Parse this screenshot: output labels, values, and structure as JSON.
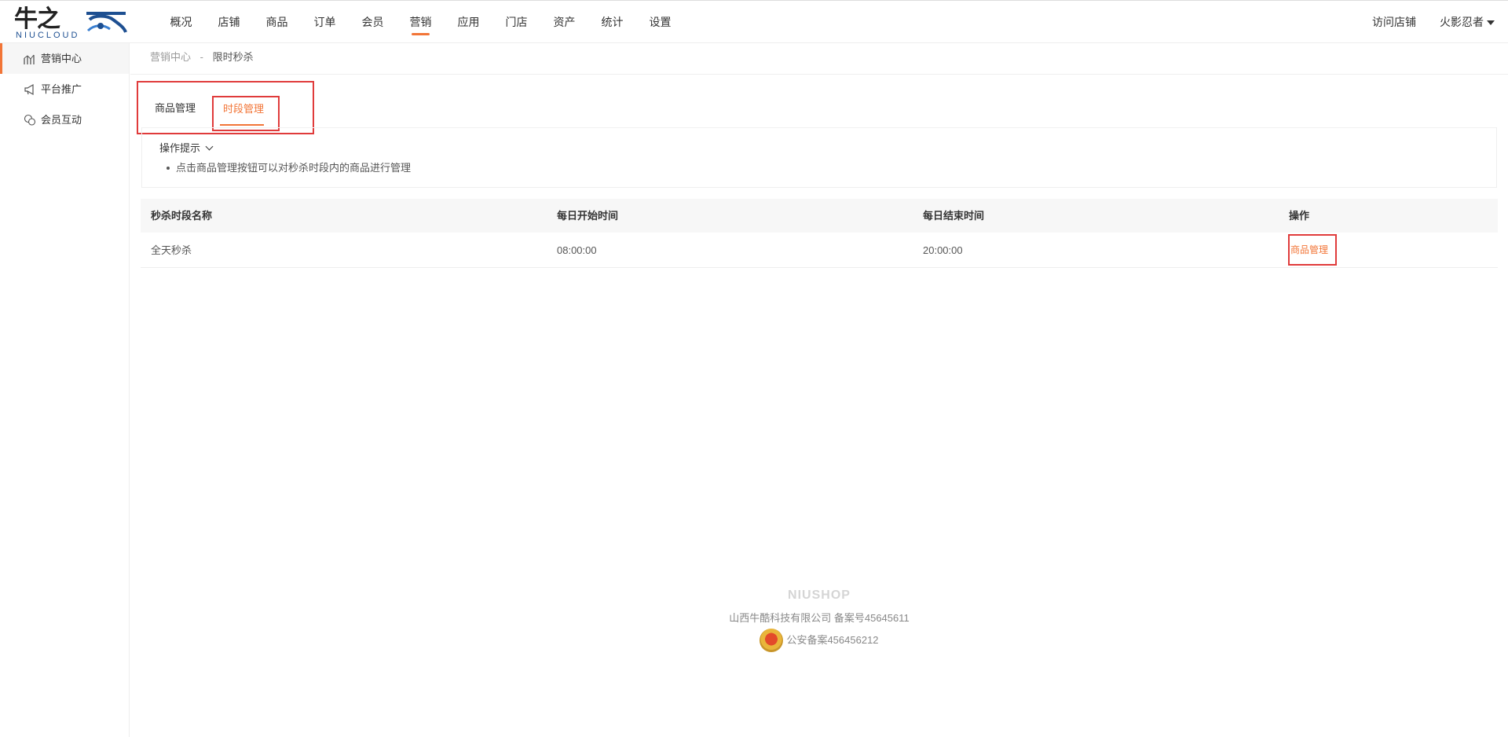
{
  "logo": {
    "cn": "牛之",
    "en": "NIUCLOUD"
  },
  "mainnav": [
    {
      "label": "概况"
    },
    {
      "label": "店铺"
    },
    {
      "label": "商品"
    },
    {
      "label": "订单"
    },
    {
      "label": "会员"
    },
    {
      "label": "营销",
      "active": true
    },
    {
      "label": "应用"
    },
    {
      "label": "门店"
    },
    {
      "label": "资产"
    },
    {
      "label": "统计"
    },
    {
      "label": "设置"
    }
  ],
  "header": {
    "visit_store": "访问店铺",
    "user": "火影忍者"
  },
  "sidebar": {
    "items": [
      {
        "label": "营销中心",
        "icon": "chart-icon",
        "active": true
      },
      {
        "label": "平台推广",
        "icon": "megaphone-icon"
      },
      {
        "label": "会员互动",
        "icon": "chat-icon"
      }
    ]
  },
  "breadcrumb": {
    "parent": "营销中心",
    "separator": "-",
    "current": "限时秒杀"
  },
  "tabs": {
    "goods": "商品管理",
    "period": "时段管理"
  },
  "tips": {
    "title": "操作提示",
    "line1": "点击商品管理按钮可以对秒杀时段内的商品进行管理"
  },
  "table": {
    "headers": [
      "秒杀时段名称",
      "每日开始时间",
      "每日结束时间",
      "操作"
    ],
    "rows": [
      {
        "name": "全天秒杀",
        "start": "08:00:00",
        "end": "20:00:00",
        "action": "商品管理"
      }
    ]
  },
  "footer": {
    "brand": "NIUSHOP",
    "company": "山西牛酷科技有限公司  备案号45645611",
    "police": "公安备案456456212"
  },
  "colors": {
    "accent": "#f27537",
    "highlight_box": "#e03b3b"
  }
}
